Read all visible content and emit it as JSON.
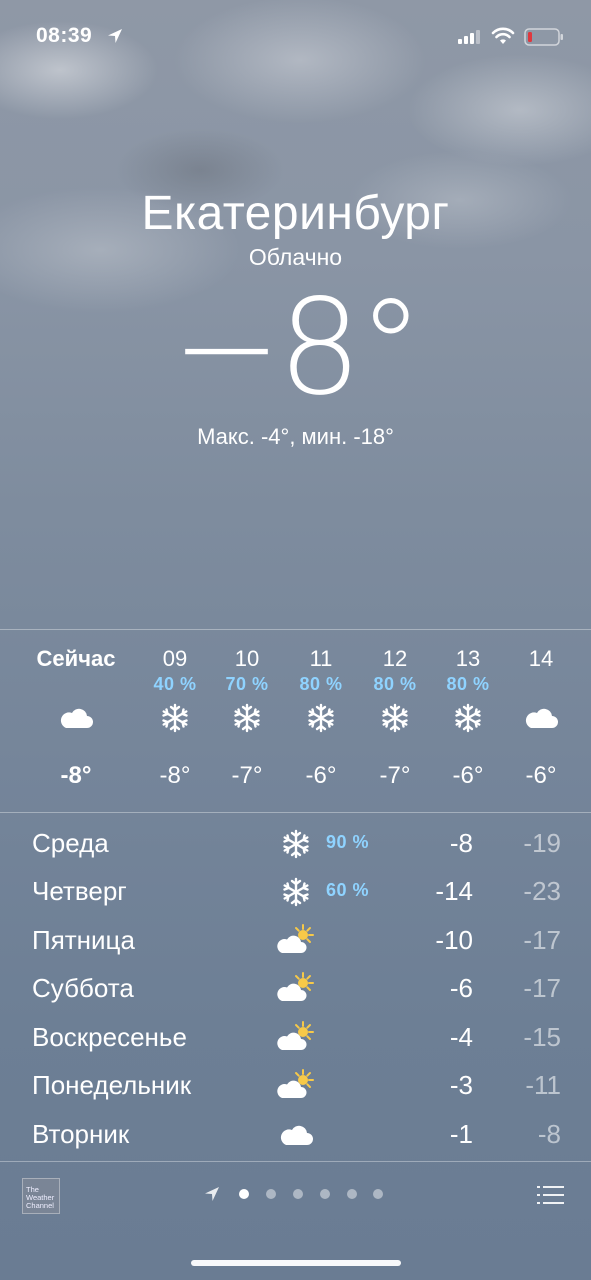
{
  "status_bar": {
    "time": "08:39",
    "icons": [
      "location-arrow-icon",
      "signal-icon",
      "wifi-icon",
      "battery-low-icon"
    ],
    "battery_color": "#e0383e"
  },
  "weather": {
    "city": "Екатеринбург",
    "condition": "Облачно",
    "temperature": "−8°",
    "hi_lo": "Макс. -4°, мин. -18°"
  },
  "colors": {
    "precip_blue": "#8fd3ff",
    "sun_yellow": "#f7c948"
  },
  "hourly": [
    {
      "label": "Сейчас",
      "precip": "",
      "icon": "cloud-icon",
      "temp": "-8°"
    },
    {
      "label": "09",
      "precip": "40 %",
      "icon": "snowflake-icon",
      "temp": "-8°"
    },
    {
      "label": "10",
      "precip": "70 %",
      "icon": "snowflake-icon",
      "temp": "-7°"
    },
    {
      "label": "11",
      "precip": "80 %",
      "icon": "snowflake-icon",
      "temp": "-6°"
    },
    {
      "label": "12",
      "precip": "80 %",
      "icon": "snowflake-icon",
      "temp": "-7°"
    },
    {
      "label": "13",
      "precip": "80 %",
      "icon": "snowflake-icon",
      "temp": "-6°"
    },
    {
      "label": "14",
      "precip": "",
      "icon": "cloud-icon",
      "temp": "-6°"
    }
  ],
  "daily": [
    {
      "day": "Среда",
      "icon": "snowflake-icon",
      "precip": "90 %",
      "max": "-8",
      "min": "-19"
    },
    {
      "day": "Четверг",
      "icon": "snowflake-icon",
      "precip": "60 %",
      "max": "-14",
      "min": "-23"
    },
    {
      "day": "Пятница",
      "icon": "partly-sunny-icon",
      "precip": "",
      "max": "-10",
      "min": "-17"
    },
    {
      "day": "Суббота",
      "icon": "partly-sunny-icon",
      "precip": "",
      "max": "-6",
      "min": "-17"
    },
    {
      "day": "Воскресенье",
      "icon": "partly-sunny-icon",
      "precip": "",
      "max": "-4",
      "min": "-15"
    },
    {
      "day": "Понедельник",
      "icon": "partly-sunny-icon",
      "precip": "",
      "max": "-3",
      "min": "-11"
    },
    {
      "day": "Вторник",
      "icon": "cloud-icon",
      "precip": "",
      "max": "-1",
      "min": "-8"
    }
  ],
  "footer": {
    "logo_text": "The Weather Channel",
    "page_count": 6,
    "active_page": 1,
    "icons": [
      "twc-logo-icon",
      "location-arrow-icon",
      "list-icon"
    ]
  }
}
